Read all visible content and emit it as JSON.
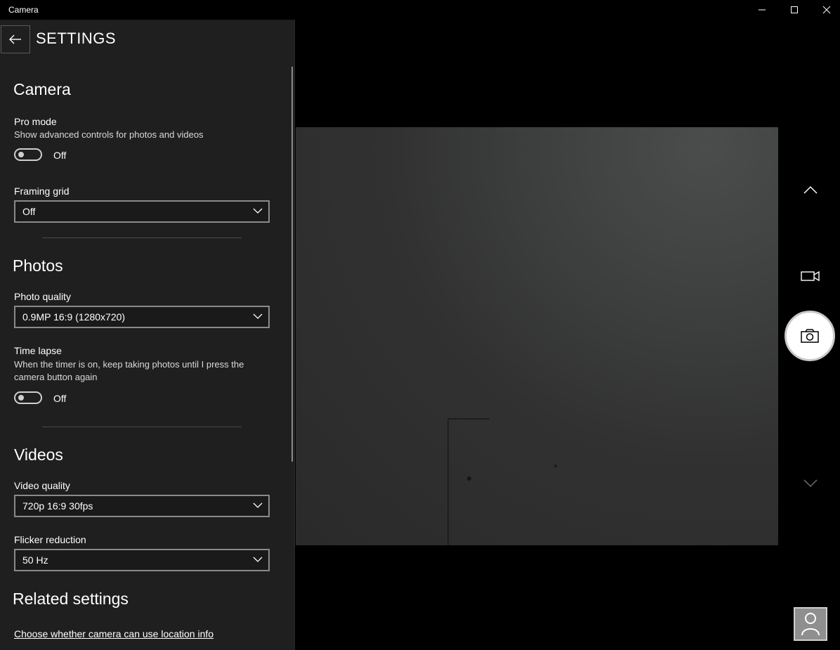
{
  "window": {
    "title": "Camera"
  },
  "settings": {
    "title": "SETTINGS",
    "camera_section": {
      "heading": "Camera",
      "pro_mode": {
        "label": "Pro mode",
        "description": "Show advanced controls for photos and videos",
        "state": "Off"
      },
      "framing_grid": {
        "label": "Framing grid",
        "value": "Off"
      }
    },
    "photos_section": {
      "heading": "Photos",
      "photo_quality": {
        "label": "Photo quality",
        "value": "0.9MP 16:9 (1280x720)"
      },
      "time_lapse": {
        "label": "Time lapse",
        "description_line1": "When the timer is on, keep taking photos until I press the",
        "description_line2": "camera button again",
        "state": "Off"
      }
    },
    "videos_section": {
      "heading": "Videos",
      "video_quality": {
        "label": "Video quality",
        "value": "720p 16:9 30fps"
      },
      "flicker_reduction": {
        "label": "Flicker reduction",
        "value": "50 Hz"
      }
    },
    "related_section": {
      "heading": "Related settings",
      "location_link": "Choose whether camera can use location info"
    }
  },
  "controls": {
    "icons": [
      "chevron-up-icon",
      "video-camera-icon",
      "photo-camera-icon",
      "chevron-down-icon"
    ]
  }
}
